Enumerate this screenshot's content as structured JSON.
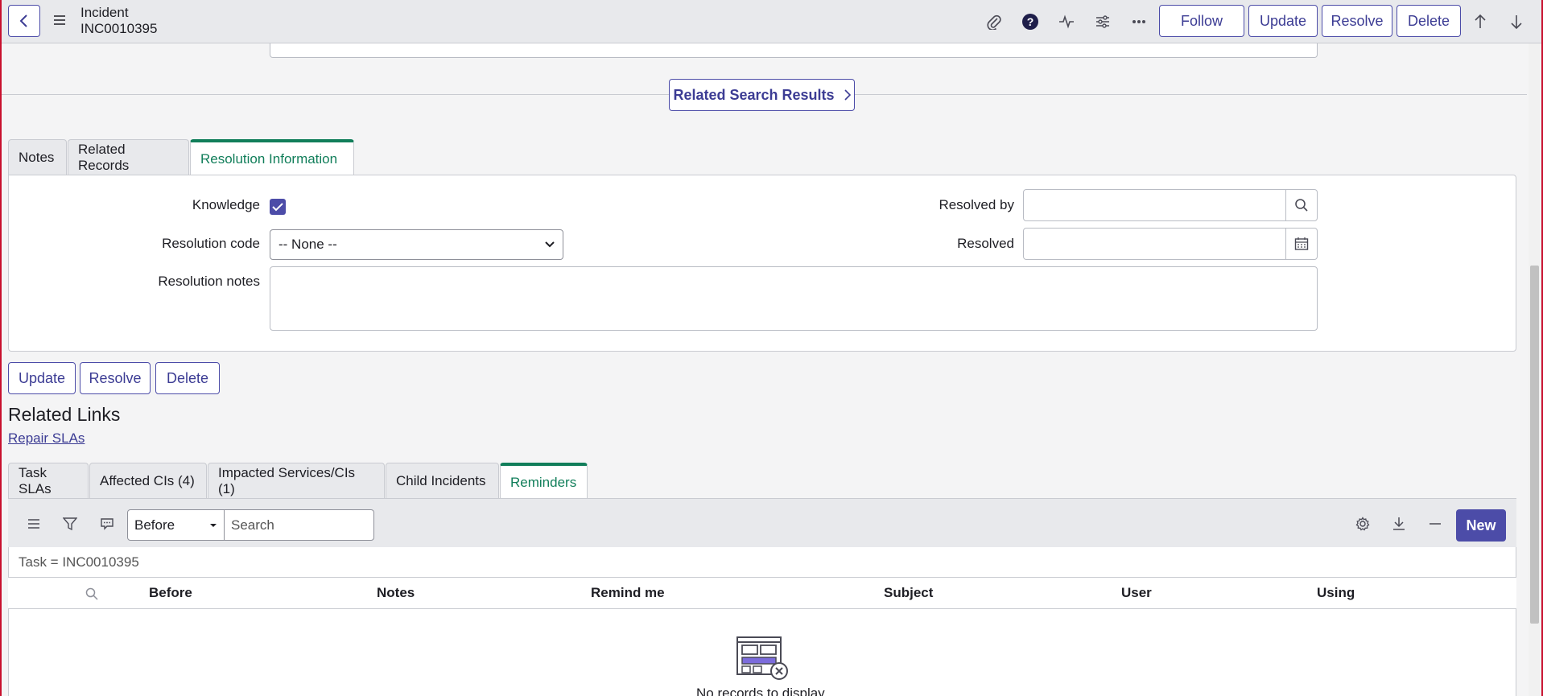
{
  "header": {
    "title": "Incident",
    "record_number": "INC0010395",
    "buttons": {
      "follow": "Follow",
      "update": "Update",
      "resolve": "Resolve",
      "delete": "Delete"
    }
  },
  "related_search": {
    "label": "Related Search Results"
  },
  "form_tabs": [
    {
      "label": "Notes"
    },
    {
      "label": "Related Records"
    },
    {
      "label": "Resolution Information"
    }
  ],
  "resolution": {
    "knowledge_label": "Knowledge",
    "knowledge_checked": true,
    "resolution_code_label": "Resolution code",
    "resolution_code_value": "-- None --",
    "resolution_notes_label": "Resolution notes",
    "resolved_by_label": "Resolved by",
    "resolved_label": "Resolved"
  },
  "bottom_buttons": {
    "update": "Update",
    "resolve": "Resolve",
    "delete": "Delete"
  },
  "related_links": {
    "title": "Related Links",
    "repair_slas": "Repair SLAs"
  },
  "list_tabs": [
    {
      "label": "Task SLAs"
    },
    {
      "label": "Affected CIs (4)"
    },
    {
      "label": "Impacted Services/CIs (1)"
    },
    {
      "label": "Child Incidents"
    },
    {
      "label": "Reminders"
    }
  ],
  "list": {
    "search_field": "Before",
    "search_placeholder": "Search",
    "new_label": "New",
    "filter": "Task = INC0010395",
    "columns": [
      "Before",
      "Notes",
      "Remind me",
      "Subject",
      "User",
      "Using"
    ],
    "empty_text": "No records to display"
  },
  "colors": {
    "accent": "#4c4ca8",
    "active_tab": "#117e5a",
    "frame": "#c8102e"
  }
}
